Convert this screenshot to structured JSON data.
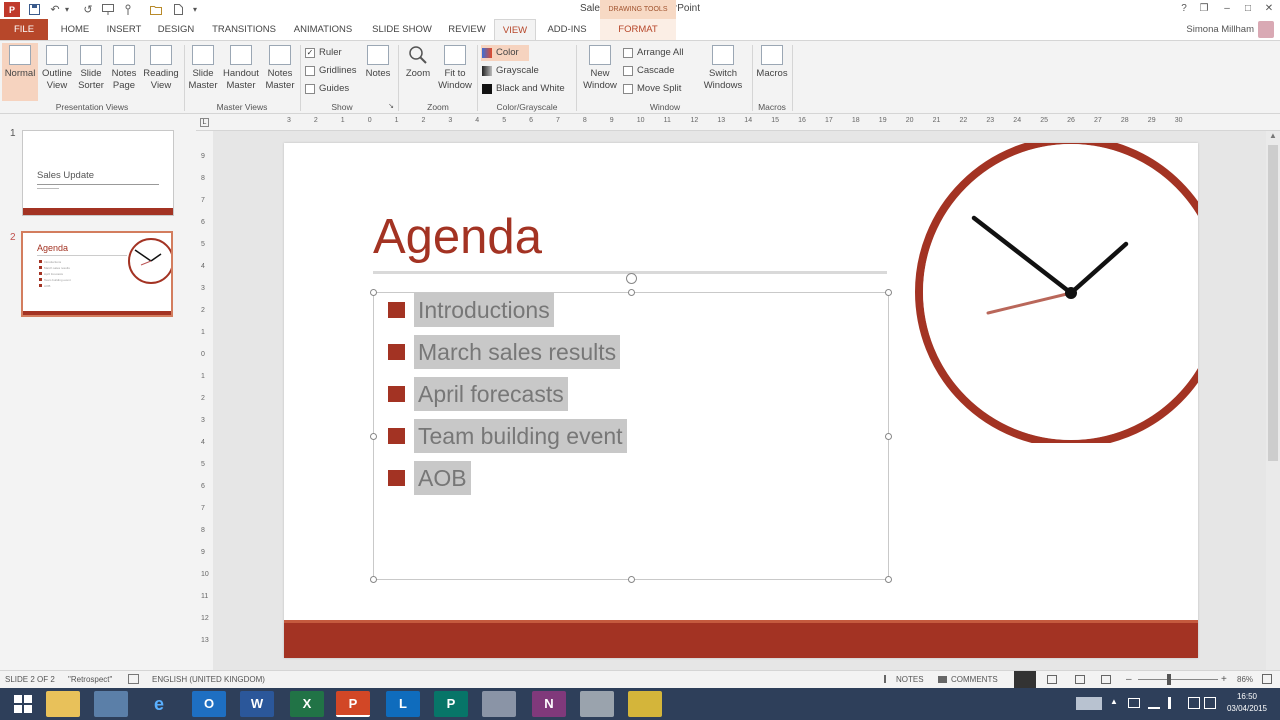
{
  "window": {
    "title": "Sales Update - PowerPoint",
    "context_tool": "DRAWING TOOLS",
    "help": "?",
    "restore": "❐",
    "minimize": "–",
    "maximize": "□",
    "close": "✕"
  },
  "qat": {
    "undo": "↶",
    "redo": "↺",
    "dropdown": "▾"
  },
  "tabs": [
    "FILE",
    "HOME",
    "INSERT",
    "DESIGN",
    "TRANSITIONS",
    "ANIMATIONS",
    "SLIDE SHOW",
    "REVIEW",
    "VIEW",
    "ADD-INS",
    "FORMAT"
  ],
  "user": {
    "name": "Simona Millham"
  },
  "ribbon": {
    "presentation_views": {
      "label": "Presentation Views",
      "normal": "Normal",
      "outline": "Outline View",
      "sorter": "Slide Sorter",
      "notes_page": "Notes Page",
      "reading": "Reading View"
    },
    "master_views": {
      "label": "Master Views",
      "slide_master": "Slide Master",
      "handout_master": "Handout Master",
      "notes_master": "Notes Master"
    },
    "show": {
      "label": "Show",
      "ruler": "Ruler",
      "gridlines": "Gridlines",
      "guides": "Guides",
      "notes": "Notes",
      "launcher": "↘",
      "ruler_checked": "✓"
    },
    "zoom": {
      "label": "Zoom",
      "zoom": "Zoom",
      "fit": "Fit to Window"
    },
    "color": {
      "label": "Color/Grayscale",
      "color": "Color",
      "grayscale": "Grayscale",
      "bw": "Black and White"
    },
    "window": {
      "label": "Window",
      "new_window": "New Window",
      "arrange_all": "Arrange All",
      "cascade": "Cascade",
      "move_split": "Move Split",
      "switch": "Switch Windows"
    },
    "macros": {
      "label": "Macros",
      "macros": "Macros"
    }
  },
  "thumbs": {
    "slide1": {
      "num": "1",
      "title": "Sales Update"
    },
    "slide2": {
      "num": "2",
      "title": "Agenda",
      "items": [
        "Introductions",
        "March sales results",
        "April forecasts",
        "Team building event",
        "AOB"
      ]
    }
  },
  "ruler": {
    "h_labels": [
      "3",
      "2",
      "1",
      "0",
      "1",
      "2",
      "3",
      "4",
      "5",
      "6",
      "7",
      "8",
      "9",
      "10",
      "11",
      "12",
      "13",
      "14",
      "15",
      "16",
      "17",
      "18",
      "19",
      "20",
      "21",
      "22",
      "23",
      "24",
      "25",
      "26",
      "27",
      "28",
      "29",
      "30"
    ],
    "v_labels": [
      "9",
      "8",
      "7",
      "6",
      "5",
      "4",
      "3",
      "2",
      "1",
      "0",
      "1",
      "2",
      "3",
      "4",
      "5",
      "6",
      "7",
      "8",
      "9",
      "10",
      "11",
      "12",
      "13"
    ]
  },
  "slide": {
    "title": "Agenda",
    "bullets": [
      "Introductions",
      "March sales results",
      "April forecasts",
      "Team building event",
      "AOB"
    ]
  },
  "status": {
    "slide": "SLIDE 2 OF 2",
    "theme": "\"Retrospect\"",
    "language": "ENGLISH (UNITED KINGDOM)",
    "notes": "NOTES",
    "comments": "COMMENTS",
    "zoom_minus": "–",
    "zoom_plus": "+",
    "zoom": "86%"
  },
  "clock": {
    "time": "16:50",
    "date": "03/04/2015"
  },
  "taskbar": {
    "outlook": "O",
    "word": "W",
    "excel": "X",
    "ppt": "P",
    "lync": "L",
    "publisher": "P",
    "onenote": "N"
  },
  "colors": {
    "accent": "#a33323",
    "ribbon_accent": "#b7472a",
    "taskbar": "#2e3f5a"
  }
}
